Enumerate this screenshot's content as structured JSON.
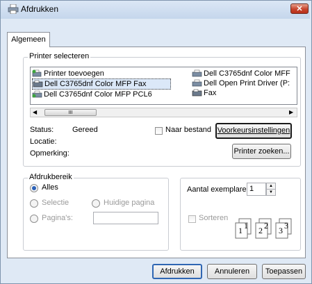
{
  "window": {
    "title": "Afdrukken",
    "close_symbol": "✕"
  },
  "tabs": [
    {
      "label": "Algemeen"
    }
  ],
  "printer_group": {
    "legend": "Printer selecteren",
    "printers_left": [
      {
        "label": "Printer toevoegen",
        "icon": "add-printer-icon"
      },
      {
        "label": "Dell C3765dnf Color MFP Fax",
        "icon": "fax-icon",
        "selected": true
      },
      {
        "label": "Dell C3765dnf Color MFP PCL6",
        "icon": "printer-icon"
      }
    ],
    "printers_right": [
      {
        "label": "Dell C3765dnf Color MFF",
        "icon": "printer-icon"
      },
      {
        "label": "Dell Open Print Driver (P:",
        "icon": "printer-icon"
      },
      {
        "label": "Fax",
        "icon": "fax-icon"
      }
    ],
    "scroll_thumb": "III",
    "status_label": "Status:",
    "status_value": "Gereed",
    "location_label": "Locatie:",
    "comment_label": "Opmerking:",
    "print_to_file_label": "Naar bestand",
    "preferences_button": "Voorkeursinstellingen",
    "find_printer_button": "Printer zoeken..."
  },
  "range_group": {
    "legend": "Afdrukbereik",
    "all": "Alles",
    "selection": "Selectie",
    "current_page": "Huidige pagina",
    "pages": "Pagina's:",
    "pages_value": ""
  },
  "copies_group": {
    "count_label": "Aantal exemplaren:",
    "count_value": "1",
    "collate_label": "Sorteren",
    "collate_pages": [
      "1",
      "1",
      "2",
      "2",
      "3",
      "3"
    ]
  },
  "buttons": {
    "print": "Afdrukken",
    "cancel": "Annuleren",
    "apply": "Toepassen"
  }
}
